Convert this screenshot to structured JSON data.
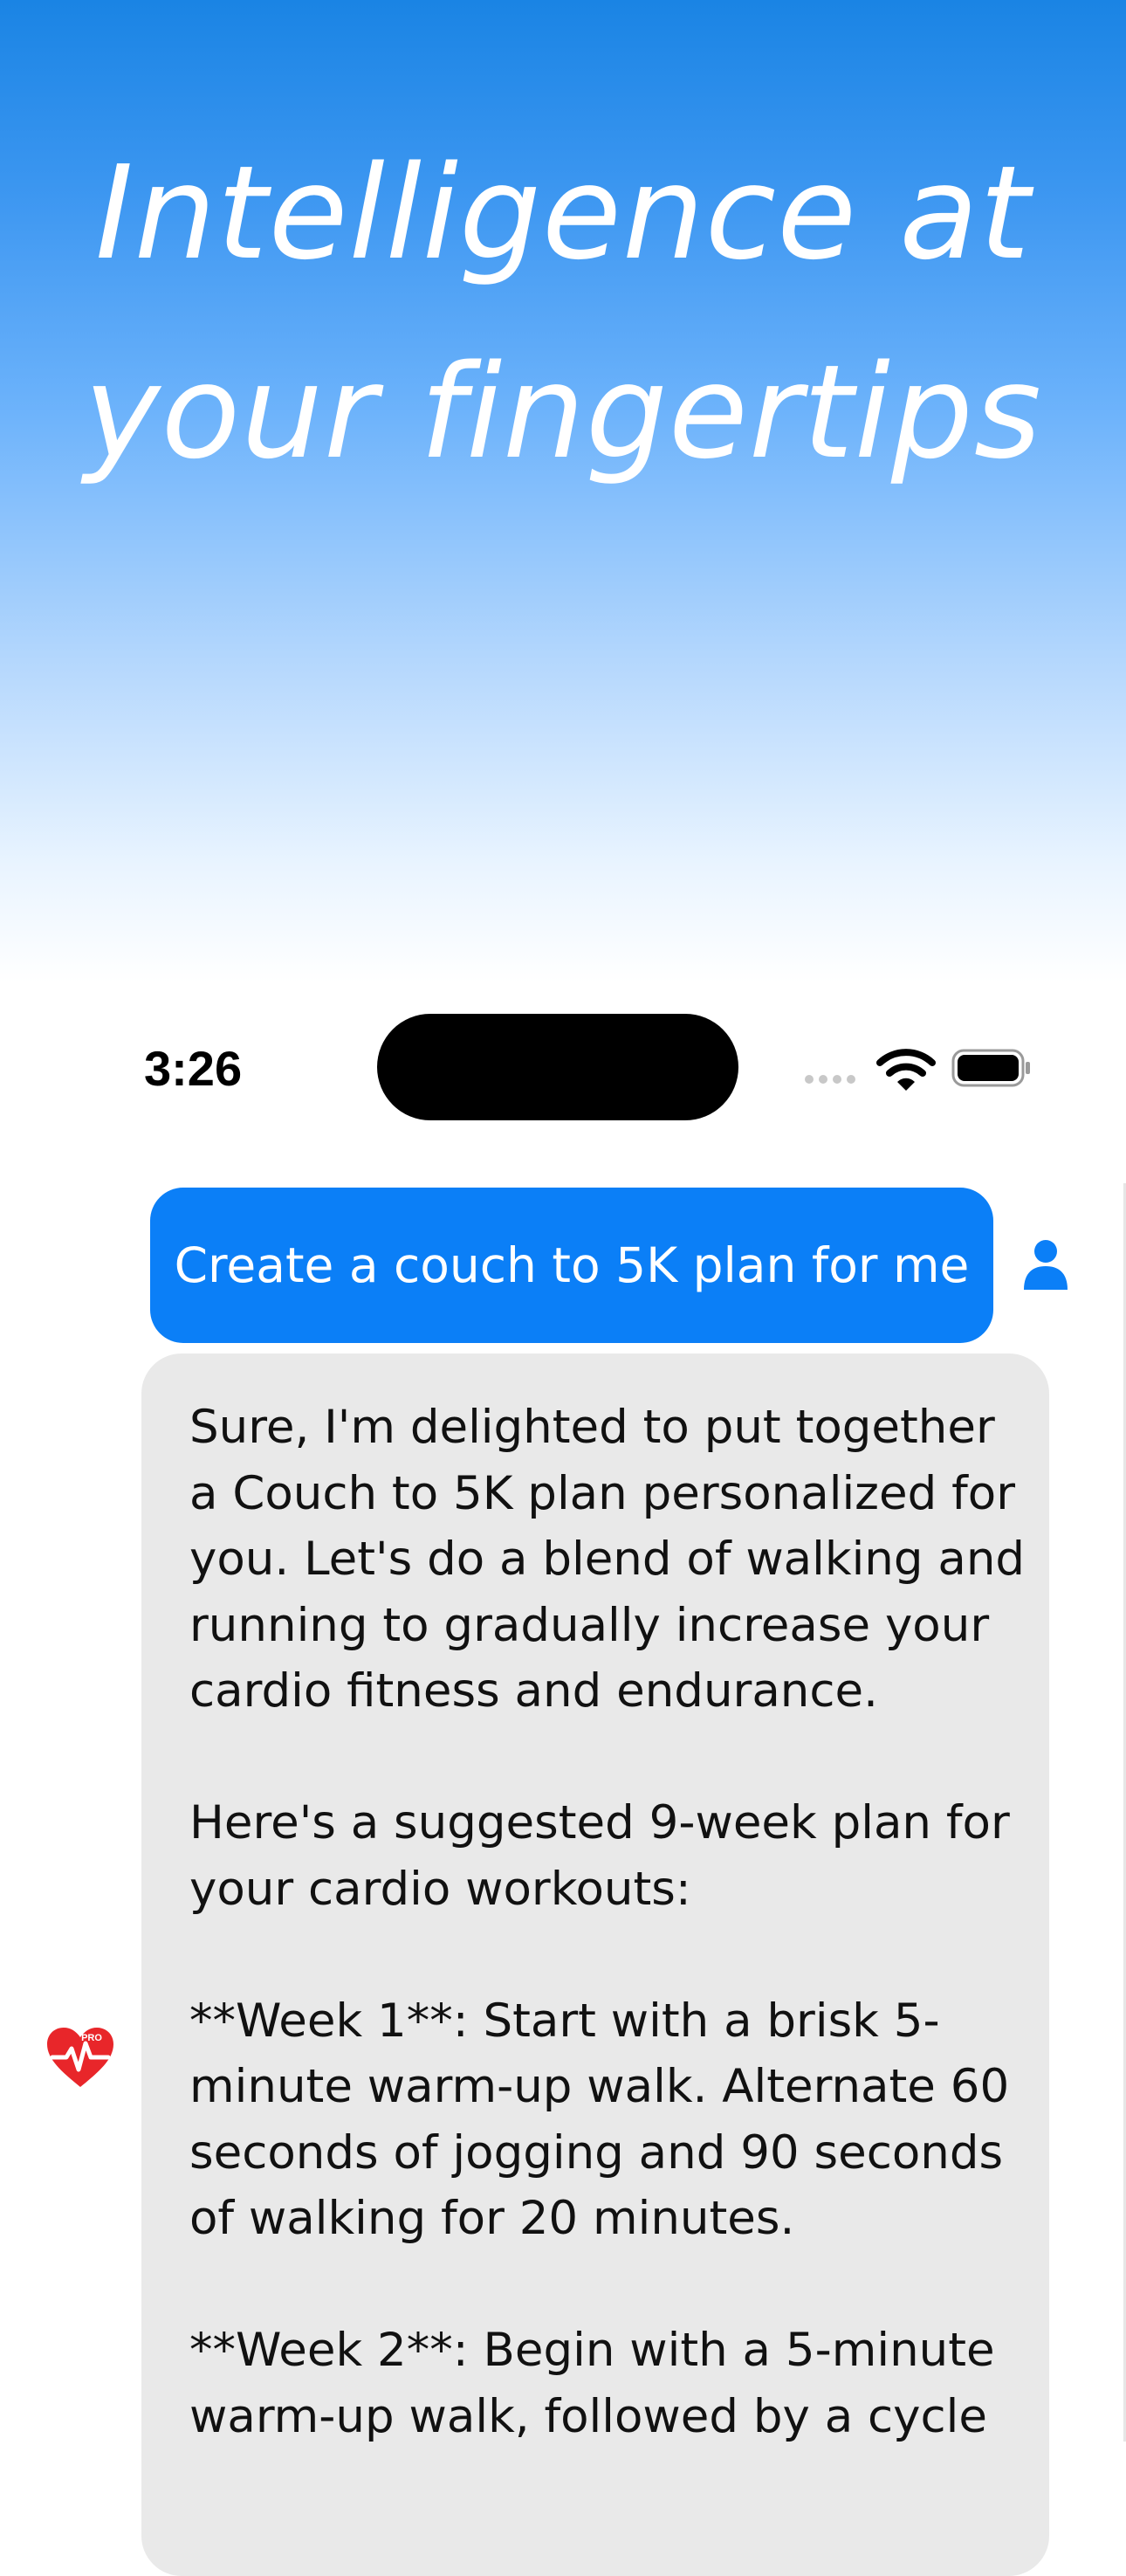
{
  "hero": {
    "line1": "Intelligence at",
    "line2": "your fingertips"
  },
  "status_bar": {
    "time": "3:26",
    "icons": [
      "signal-dots-icon",
      "wifi-icon",
      "battery-icon"
    ]
  },
  "chat": {
    "user_message": "Create a couch to 5K plan for me",
    "assistant_paragraphs": [
      "Sure, I'm delighted to put together a Couch to 5K plan personalized for you. Let's do a blend of walking and running to gradually increase your cardio fitness and endurance.",
      "Here's a suggested 9-week plan for your cardio workouts:",
      "**Week 1**: Start with a brisk 5-minute warm-up walk. Alternate 60 seconds of jogging and 90 seconds of walking for 20 minutes.",
      "**Week 2**: Begin with a 5-minute warm-up walk, followed by a cycle"
    ],
    "app_icon_badge": "PRO"
  },
  "colors": {
    "user_bubble": "#0b7ff7",
    "assistant_bubble": "#e9e9e9",
    "heart_icon": "#e8262a",
    "hero_top": "#1a84e4"
  }
}
